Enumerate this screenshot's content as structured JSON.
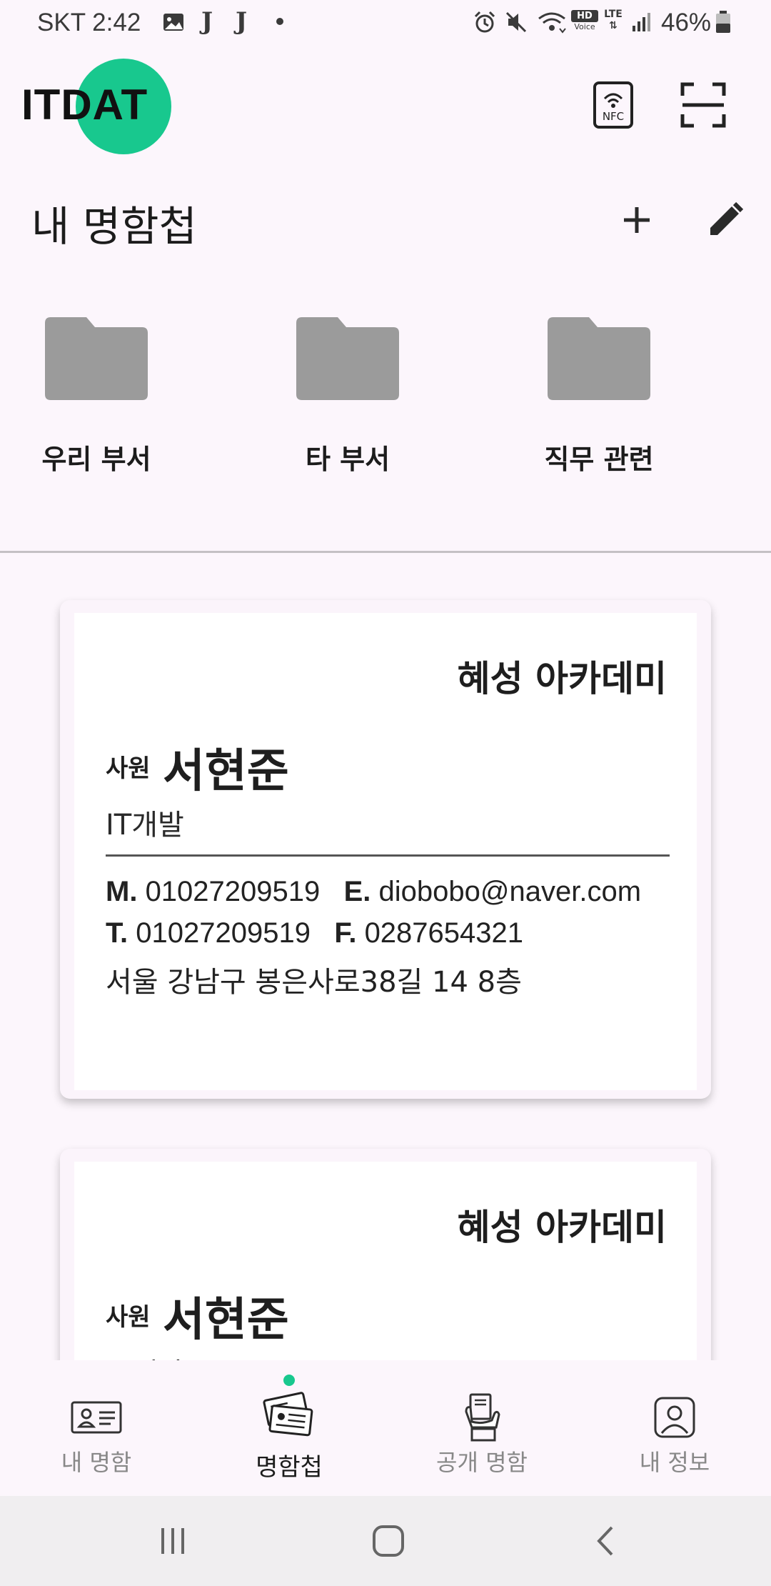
{
  "status_bar": {
    "time": "SKT 2:42",
    "battery": "46%",
    "left_icons": [
      "gallery-icon",
      "j-notification-icon",
      "j-notification-icon",
      "dot-icon"
    ],
    "right_icons": [
      "alarm-icon",
      "mute-icon",
      "wifi-icon",
      "hd-voice-icon",
      "lte-icon",
      "signal-icon",
      "battery-icon"
    ]
  },
  "header": {
    "logo": "ITDAT",
    "nfc_label": "NFC",
    "accent_color": "#18c88e"
  },
  "section": {
    "title": "내 명함첩"
  },
  "folders": [
    {
      "label": "우리 부서"
    },
    {
      "label": "타 부서"
    },
    {
      "label": "직무 관련"
    }
  ],
  "cards": [
    {
      "company": "혜성 아카데미",
      "rank": "사원",
      "name": "서현준",
      "department": "IT개발",
      "mobile_label": "M.",
      "mobile": "01027209519",
      "email_label": "E.",
      "email": "diobobo@naver.com",
      "tel_label": "T.",
      "tel": "01027209519",
      "fax_label": "F.",
      "fax": "0287654321",
      "address": "서울 강남구 봉은사로38길 14 8층"
    },
    {
      "company": "혜성 아카데미",
      "rank": "사원",
      "name": "서현준",
      "department": "IT개발"
    }
  ],
  "bottom_nav": {
    "items": [
      {
        "label": "내 명함",
        "icon": "id-card-icon",
        "active": false
      },
      {
        "label": "명함첩",
        "icon": "card-stack-icon",
        "active": true
      },
      {
        "label": "공개 명함",
        "icon": "hand-card-icon",
        "active": false
      },
      {
        "label": "내 정보",
        "icon": "profile-icon",
        "active": false
      }
    ]
  },
  "system_nav": [
    "recents-icon",
    "home-icon",
    "back-icon"
  ]
}
